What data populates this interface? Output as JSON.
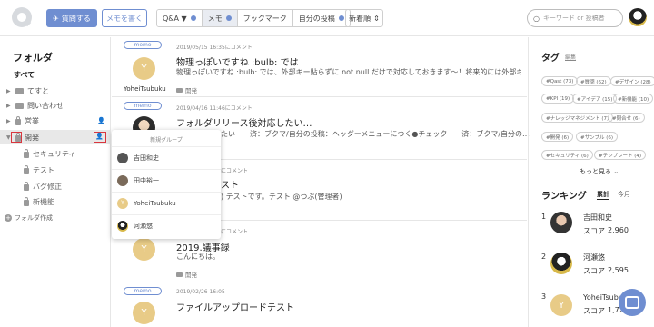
{
  "header": {
    "ask_button": "質問する",
    "memo_button": "メモを書く",
    "tabs": [
      {
        "label": "Q&A ▼",
        "dot": true
      },
      {
        "label": "メモ",
        "dot": true
      },
      {
        "label": "ブックマーク",
        "dot": false
      },
      {
        "label": "自分の投稿",
        "dot": true
      }
    ],
    "sort_label": "新着順",
    "search_placeholder": "キーワード or 投稿者"
  },
  "sidebar": {
    "title": "フォルダ",
    "all_label": "すべて",
    "folders": [
      "てすと",
      "問い合わせ",
      "営業",
      "開発"
    ],
    "subfolders": [
      "セキュリティ",
      "テスト",
      "バグ修正",
      "新機能"
    ],
    "add_folder": "フォルダ作成"
  },
  "posts": [
    {
      "badge": "memo",
      "date": "2019/05/15 16:35にコメント",
      "title": "物理っぽいですね :bulb: では",
      "body": "物理っぽいですね :bulb: では、外部キー貼らずに not null だけで対応しておきます〜！将来的には外部キ…",
      "folder": "開発",
      "user": "YoheiTsubuku",
      "avatar_letter": "Y"
    },
    {
      "badge": "memo",
      "date": "2019/04/16 11:46にコメント",
      "title": "フォルダリリース後対応したい…",
      "body": "たい　　済：ブクマ/自分の投稿：ヘッダーメニューにつく●チェック　　済：ブクマ/自分の…",
      "folder": "開発",
      "user": "",
      "avatar_letter": ""
    },
    {
      "badge": "",
      "date": "にコメント",
      "title": "スト",
      "body": ") テストです。テスト @つぶ(管理者)",
      "folder": "",
      "user": "",
      "avatar_letter": ""
    },
    {
      "badge": "",
      "date": "にコメント",
      "title": "2019.議事録",
      "body": "こんにちは。",
      "folder": "開発",
      "user": "",
      "avatar_letter": "Y"
    },
    {
      "badge": "memo",
      "date": "2019/02/26 16:05",
      "title": "ファイルアップロードテスト",
      "body": "",
      "folder": "",
      "user": "",
      "avatar_letter": "Y"
    }
  ],
  "dropdown": {
    "header": "新規グループ",
    "members": [
      "吉田和史",
      "田中裕一",
      "YoheiTsubuku",
      "河瀬悠"
    ]
  },
  "tags": {
    "title": "タグ",
    "edit": "編集",
    "items": [
      "#Qast (73)",
      "#質問 (62)",
      "#デザイン (28)",
      "#KPI (19)",
      "#アイデア (15)",
      "#新機能 (10)",
      "#ナレッジマネジメント (7)",
      "#問合せ (6)",
      "#開発 (6)",
      "#サンプル (6)",
      "#セキュリティ (6)",
      "#テンプレート (4)"
    ],
    "more": "もっと見る"
  },
  "ranking": {
    "title": "ランキング",
    "tab_total": "累計",
    "tab_month": "今月",
    "score_label": "スコア",
    "entries": [
      {
        "rank": "1",
        "name": "吉田和史",
        "score": "2,960"
      },
      {
        "rank": "2",
        "name": "河瀬悠",
        "score": "2,595"
      },
      {
        "rank": "3",
        "name": "YoheiTsubuku",
        "score": "1,72",
        "avatar_letter": "Y"
      }
    ]
  }
}
